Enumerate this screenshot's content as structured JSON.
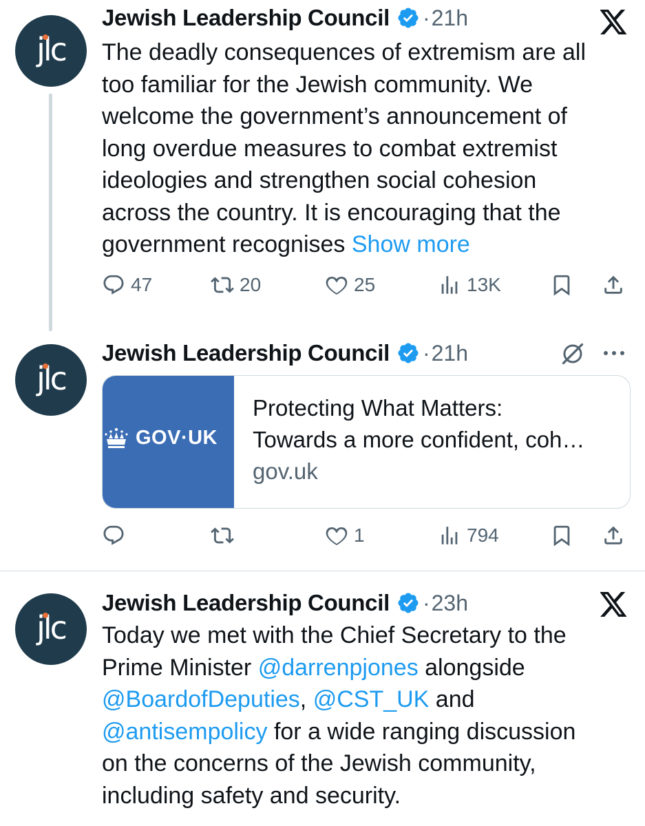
{
  "tweets": [
    {
      "author": "Jewish Leadership Council",
      "avatar_text": "jlc",
      "time": "21h",
      "separator": "·",
      "top_icon": "x-logo-icon",
      "lines": [
        "The deadly consequences of extremism are all",
        "too familiar for the Jewish community. We",
        "welcome the government’s announcement of",
        "long overdue measures to combat extremist",
        "ideologies and strengthen social cohesion",
        "across the country. It is encouraging that the",
        "government recognises "
      ],
      "show_more": "Show more",
      "stats": {
        "replies": "47",
        "reposts": "20",
        "likes": "25",
        "views": "13K"
      }
    },
    {
      "author": "Jewish Leadership Council",
      "avatar_text": "jlc",
      "time": "21h",
      "separator": "·",
      "top_icon": "grok-icon",
      "more_icon": "more-icon",
      "card": {
        "brand": "GOV·UK",
        "title_line1": "Protecting What Matters:",
        "title_line2": "Towards a more confident, coh…",
        "domain": "gov.uk"
      },
      "stats": {
        "replies": "",
        "reposts": "",
        "likes": "1",
        "views": "794"
      }
    },
    {
      "author": "Jewish Leadership Council",
      "avatar_text": "jlc",
      "time": "23h",
      "separator": "·",
      "top_icon": "x-logo-icon",
      "line1": "Today we met with the Chief Secretary to the",
      "line2_a": "Prime Minister ",
      "mention1": "@darrenpjones",
      "line2_b": " alongside",
      "mention2": "@BoardofDeputies",
      "line3_a": ", ",
      "mention3": "@CST_UK",
      "line3_b": " and",
      "mention4": "@antisempolicy",
      "line4_b": " for a wide ranging discussion",
      "line5": "on the concerns of the Jewish community,",
      "line6": "including safety and security."
    }
  ],
  "colors": {
    "link": "#1d9bf0",
    "muted": "#536471",
    "avatar_bg": "#1f3b4c",
    "card_bg": "#3b6db5",
    "verified": "#1d9bf0"
  }
}
